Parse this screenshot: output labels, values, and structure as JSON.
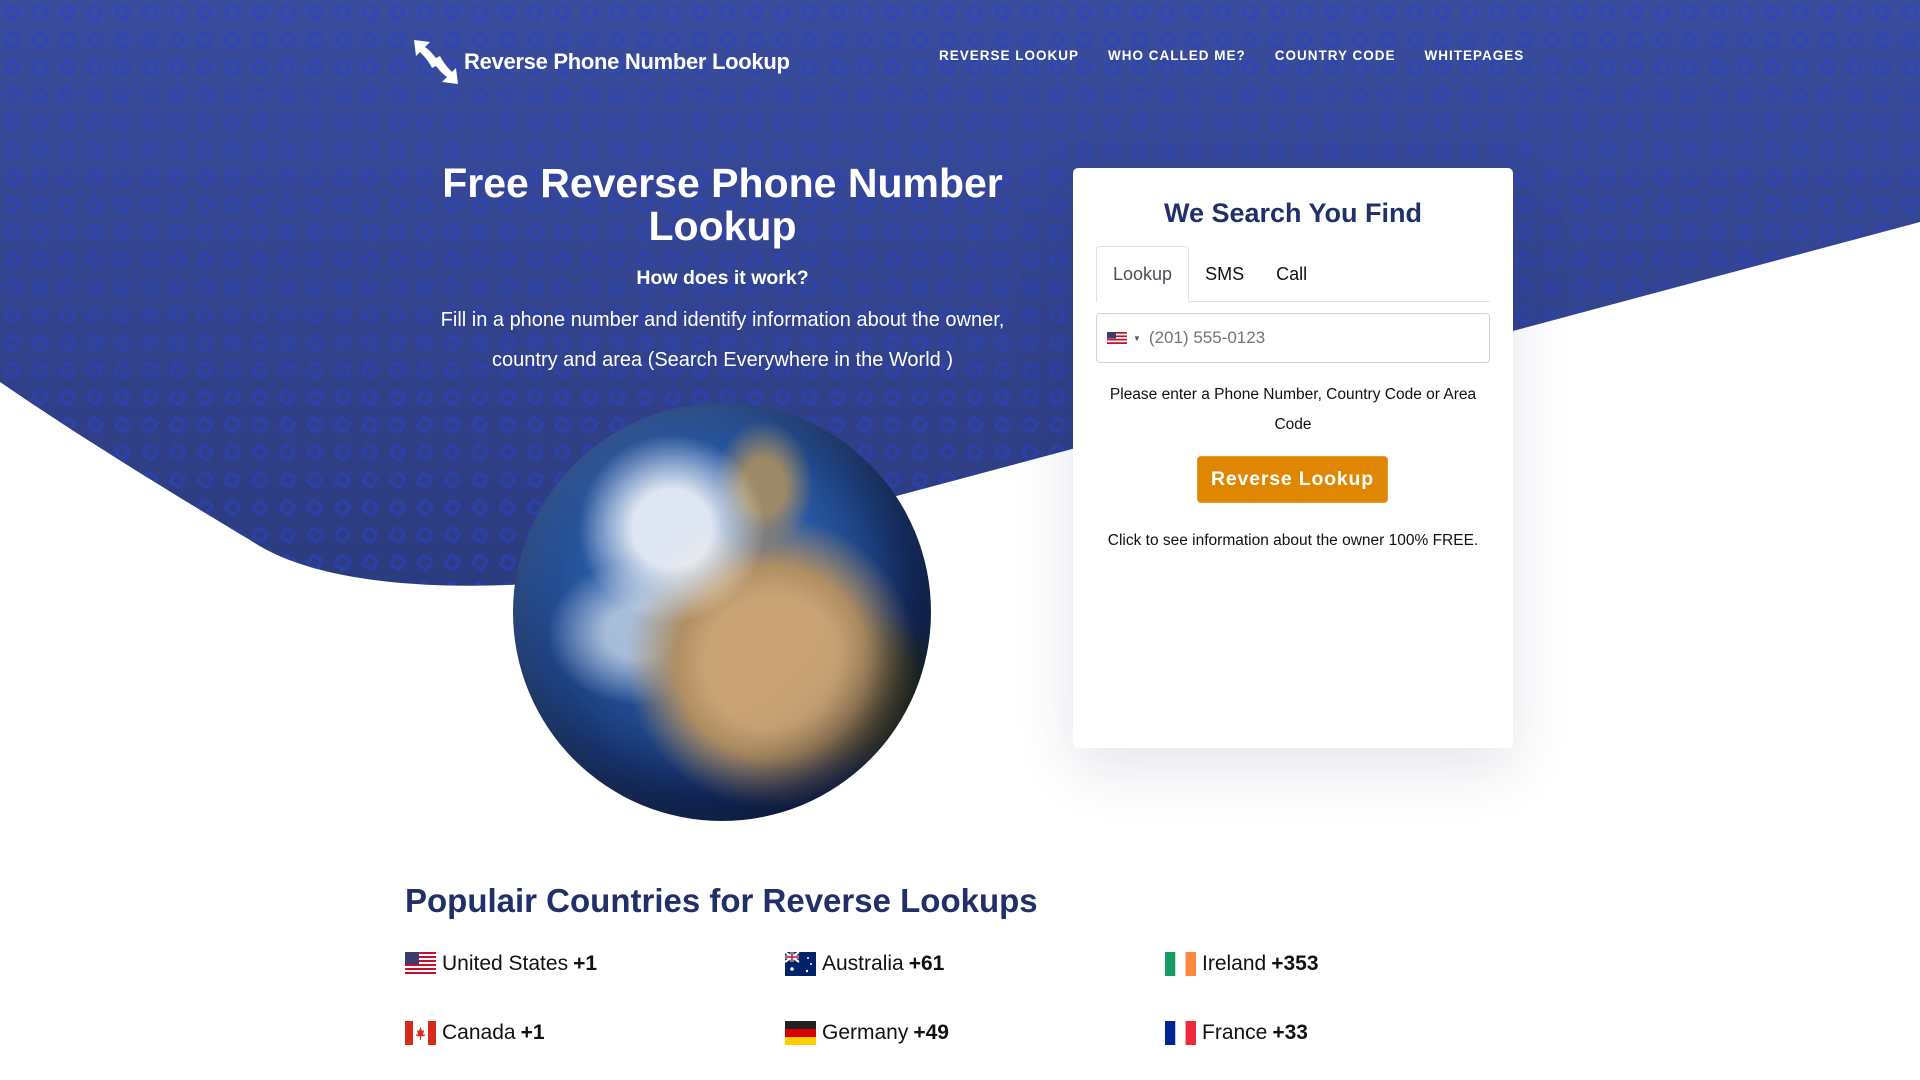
{
  "header": {
    "logo_text": "Reverse Phone Number Lookup",
    "nav": [
      {
        "label": "REVERSE LOOKUP"
      },
      {
        "label": "WHO CALLED ME?"
      },
      {
        "label": "COUNTRY CODE"
      },
      {
        "label": "WHITEPAGES"
      }
    ]
  },
  "hero": {
    "title": "Free Reverse Phone Number Lookup",
    "subtitle": "How does it work?",
    "description": "Fill in a phone number and identify information about the owner, country and area (Search Everywhere in the World )",
    "image": "earth-globe"
  },
  "search_card": {
    "title": "We Search You Find",
    "tabs": [
      {
        "label": "Lookup",
        "active": true
      },
      {
        "label": "SMS",
        "active": false
      },
      {
        "label": "Call",
        "active": false
      }
    ],
    "phone_input": {
      "country_flag": "us-flag-icon",
      "value": "",
      "placeholder": "(201) 555-0123"
    },
    "help_text": "Please enter a Phone Number, Country Code or Area Code",
    "button_label": "Reverse Lookup",
    "footer_text": "Click to see information about the owner 100% FREE."
  },
  "countries": {
    "title": "Populair Countries for Reverse Lookups",
    "items": [
      {
        "name": "United States",
        "code": "+1",
        "flag": "us"
      },
      {
        "name": "Australia",
        "code": "+61",
        "flag": "au"
      },
      {
        "name": "Ireland",
        "code": "+353",
        "flag": "ie"
      },
      {
        "name": "Canada",
        "code": "+1",
        "flag": "ca"
      },
      {
        "name": "Germany",
        "code": "+49",
        "flag": "de"
      },
      {
        "name": "France",
        "code": "+33",
        "flag": "fr"
      }
    ]
  },
  "colors": {
    "hero_bg": "#3a4c9c",
    "pattern": "#2f47b8",
    "heading": "#22306a",
    "button": "#df8703"
  }
}
